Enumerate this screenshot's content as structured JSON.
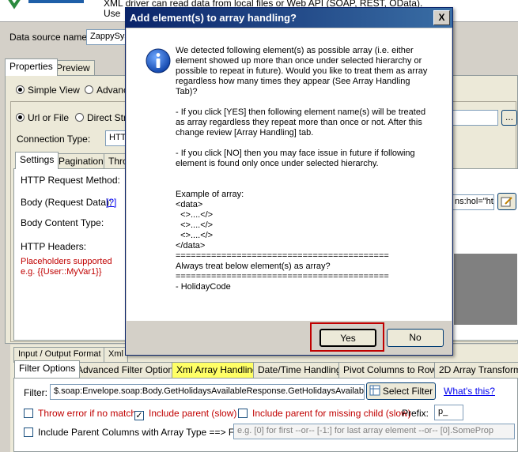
{
  "header": {
    "description_line1": "XML driver can read data from local files or Web API (SOAP, REST, OData).",
    "description_line2": "Use"
  },
  "datasource": {
    "label": "Data source name",
    "value": "ZappySys"
  },
  "main_tabs": [
    "Properties",
    "Preview"
  ],
  "view_mode": {
    "simple": "Simple View",
    "advanced": "Advanc"
  },
  "source_type": {
    "url_or_file": "Url or File",
    "direct": "Direct Stri"
  },
  "connection": {
    "label": "Connection Type:",
    "value": "HTT"
  },
  "sub_tabs": [
    "Settings",
    "Pagination",
    "Thro"
  ],
  "settings": {
    "http_request_method": "HTTP Request Method:",
    "body_label": "Body (Request Data):",
    "body_help": "[?]",
    "body_content_type": "Body Content Type:",
    "http_headers": "HTTP Headers:",
    "placeholders_line1": "Placeholders supported",
    "placeholders_line2": "e.g. {{User::MyVar1}}",
    "ellipsis_button": "...",
    "body_value_fragment": "ns:hol=\"ht"
  },
  "dialog": {
    "title": "Add element(s) to array handling?",
    "close": "X",
    "message": "We detected following element(s) as possible array (i.e. either\nelement showed up more than once under selected hierarchy or\npossible to repeat in future). Would you like to treat them as array\nregardless how many times they appear (See Array Handling\nTab)?\n\n- If you click [YES] then following element name(s) will be treated\nas array regardless they repeat more than once or not. After this\nchange review [Array Handling] tab.\n\n- If you click [NO] then you may face issue in future if following\nelement is found only once under selected hierarchy.\n\n\nExample of array:\n<data>\n  <>....</>\n  <>....</>\n  <>....</>\n</data>\n==========================================\nAlways treat below element(s) as array?\n==========================================\n- HolidayCode",
    "yes": "Yes",
    "no": "No",
    "highlight_color": "#c00000"
  },
  "bottom_tabs_row1": [
    "Input / Output Format",
    "Xml"
  ],
  "bottom_tabs_row2": [
    "Filter Options",
    "Advanced Filter Options",
    "Xml Array Handling",
    "Date/Time Handling",
    "Pivot Columns to Rows",
    "2D Array Transform"
  ],
  "filter": {
    "label": "Filter:",
    "value": "$.soap:Envelope.soap:Body.GetHolidaysAvailableResponse.GetHolidaysAvailableR",
    "select_button": "Select Filter",
    "whats_this": "What's this?"
  },
  "options": {
    "throw_error": "Throw error if no match",
    "include_parent": "Include parent (slow)",
    "include_parent_missing": "Include parent for missing child (slow)",
    "prefix_label": "Prefix:",
    "prefix_value": "p_",
    "include_parent_columns": "Include Parent Columns with Array Type ==> Filter",
    "filter_placeholder": "e.g. [0] for first --or-- [-1:] for last array element --or-- [0].SomeProp"
  }
}
